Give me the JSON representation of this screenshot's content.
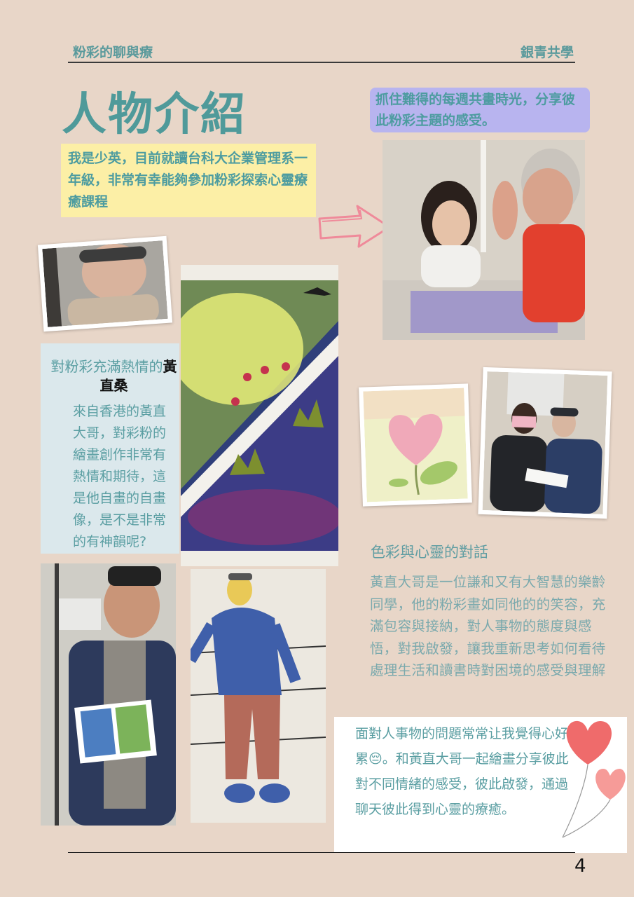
{
  "header": {
    "left": "粉彩的聊與療",
    "right": "銀青共學"
  },
  "title": "人物介紹",
  "caption_top": "抓住難得的每週共畫時光，分享彼此粉彩主題的感受。",
  "intro": "我是少英，目前就讀台科大企業管理系一年級，非常有幸能夠參加粉彩探索心靈療癒課程",
  "profile": {
    "heading_prefix": "對粉彩充滿熱情的",
    "heading_name": "黃直桑",
    "body": "來自香港的黃直大哥，對彩粉的繪畫創作非常有熱情和期待，這是他自畫的自畫像，是不是非常的有神韻呢?"
  },
  "section": {
    "heading": "色彩與心靈的對話",
    "body": "黃直大哥是一位謙和又有大智慧的樂齡同學，他的粉彩畫如同他的的笑容，充滿包容與接納，對人事物的態度與感悟，對我啟發，讓我重新思考如何看待處理生活和讀書時對困境的感受與理解"
  },
  "reflection": "面對人事物的問題常常让我覺得心好累😔。和黃直大哥一起繪畫分享彼此對不同情緒的感受，彼此啟發，通過聊天彼此得到心靈的療癒。",
  "page_number": "4",
  "colors": {
    "background": "#e8d6c8",
    "teal": "#4f9a9a",
    "purple_highlight": "#b8b4ef",
    "yellow_highlight": "#fcefa6"
  },
  "icons": {
    "arrow": "pink-arrow-icon",
    "balloons": "heart-balloons-icon"
  }
}
